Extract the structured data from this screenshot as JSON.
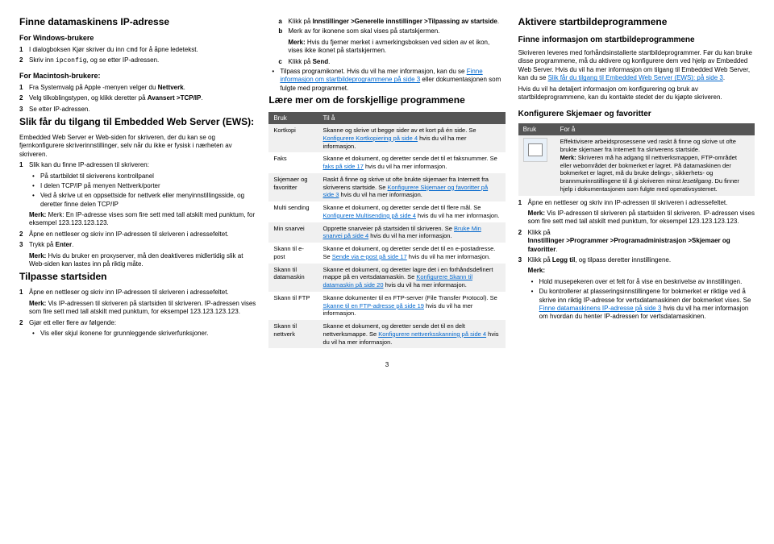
{
  "col1": {
    "h1": "Finne datamaskinens IP-adresse",
    "h2a": "For Windows-brukere",
    "s1": "I dialogboksen Kjør skriver du inn ",
    "s1_mono": "cmd",
    "s1_end": " for å åpne ledetekst.",
    "s2": "Skriv inn ",
    "s2_mono": "ipconfig",
    "s2_end": ", og se etter IP-adressen.",
    "h2b": "For Macintosh-brukere:",
    "m1": "Fra Systemvalg på Apple -menyen velger du ",
    "m1b": "Nettverk",
    "m2": "Velg tilkoblingstypen, og klikk deretter på ",
    "m2b": "Avansert >TCP/IP",
    "m3": "Se etter IP-adressen.",
    "h1b": "Slik får du tilgang til Embedded Web Server (EWS):",
    "p1": "Embedded Web Server er Web-siden for skriveren, der du kan se og fjernkonfigurere skriverinnstillinger, selv når du ikke er fysisk i nærheten av skriveren.",
    "e1": "Slik kan du finne IP-adressen til skriveren:",
    "b1": "På startbildet til skriverens kontrollpanel",
    "b2": "I delen TCP/IP på menyen Nettverk/porter",
    "b3": "Ved å skrive ut en oppsettside for nettverk eller menyinnstillingsside, og deretter finne delen TCP/IP",
    "note1": "Merk: En IP-adresse vises som fire sett med tall atskilt med punktum, for eksempel 123.123.123.123.",
    "e2": "Åpne en nettleser og skriv inn IP-adressen til skriveren i adressefeltet.",
    "e3": "Trykk på ",
    "e3b": "Enter",
    "note2a": "Merk:",
    "note2b": " Hvis du bruker en proxyserver, må den deaktiveres midlertidig slik at Web-siden kan lastes inn på riktig måte.",
    "h1c": "Tilpasse startsiden",
    "t1": "Åpne en nettleser og skriv inn IP-adressen til skriveren i adressefeltet.",
    "tnote_a": "Merk:",
    "tnote_b": " Vis IP-adressen til skriveren på startsiden til skriveren. IP-adressen vises som fire sett med tall atskilt med punktum, for eksempel 123.123.123.123.",
    "t2": "Gjør ett eller flere av følgende:",
    "tb1": "Vis eller skjul ikonene for grunnleggende skriverfunksjoner."
  },
  "col2": {
    "sa": "Klikk på ",
    "sab": "Innstillinger >Generelle innstillinger >Tilpassing av startside",
    "sb": "Merk av for ikonene som skal vises på startskjermen.",
    "merk_a": "Merk:",
    "merk_b": " Hvis du fjerner merket i avmerkingsboksen ved siden av et ikon, vises ikke ikonet på startskjermen.",
    "sc": "Klikk på ",
    "scb": "Send",
    "bul1": "Tilpass programikonet. Hvis du vil ha mer informasjon, kan du se ",
    "bul1_link": "Finne informasjon om startbildeprogrammene på side 3",
    "bul1_end": " eller dokumentasjonen som fulgte med programmet.",
    "h1": "Lære mer om de forskjellige programmene",
    "th1": "Bruk",
    "th2": "Til å",
    "r1a": "Kortkopi",
    "r1b": "Skanne og skrive ut begge sider av et kort på én side. Se ",
    "r1l": "Konfigurere Kortkopiering på side 4",
    "r1e": " hvis du vil ha mer informasjon.",
    "r2a": "Faks",
    "r2b": "Skanne et dokument, og deretter sende det til et faksnummer. Se ",
    "r2l": "faks på side 17",
    "r2e": " hvis du vil ha mer informasjon.",
    "r3a": "Skjemaer og favoritter",
    "r3b": "Raskt å finne og skrive ut ofte brukte skjemaer fra Internett fra skriverens startside. Se ",
    "r3l": "Konfigurere Skjemaer og favoritter på side 3",
    "r3e": " hvis du vil ha mer informasjon.",
    "r4a": "Multi sending",
    "r4b": "Skanne et dokument, og deretter sende det til flere mål. Se ",
    "r4l": "Konfigurere Multisending på side 4",
    "r4e": " hvis du vil ha mer informasjon.",
    "r5a": "Min snarvei",
    "r5b": "Opprette snarveier på startsiden til skriveren. Se ",
    "r5l": "Bruke Min snarvei på side 4",
    "r5e": " hvis du vil ha mer informasjon.",
    "r6a": "Skann til e-post",
    "r6b": "Skanne et dokument, og deretter sende det til en e-postadresse. Se ",
    "r6l": "Sende via e-post på side 17",
    "r6e": " hvis du vil ha mer informasjon.",
    "r7a": "Skann til datamaskin",
    "r7b": "Skanne et dokument, og deretter lagre det i en forhåndsdefinert mappe på en vertsdatamaskin. Se ",
    "r7l": "Konfigurere Skann til datamaskin på side 20",
    "r7e": " hvis du vil ha mer informasjon.",
    "r8a": "Skann til FTP",
    "r8b": "Skanne dokumenter til en FTP-server (File Transfer Protocol). Se ",
    "r8l": "Skanne til en FTP-adresse på side 19",
    "r8e": " hvis du vil ha mer informasjon.",
    "r9a": "Skann til nettverk",
    "r9b": "Skanne et dokument, og deretter sende det til en delt nettverksmappe. Se ",
    "r9l": "Konfigurere nettverksskanning på side 4",
    "r9e": " hvis du vil ha mer informasjon."
  },
  "col3": {
    "h1": "Aktivere startbildeprogrammene",
    "h2": "Finne informasjon om startbildeprogrammene",
    "p1": "Skriveren leveres med forhåndsinstallerte startbildeprogrammer. Før du kan bruke disse programmene, må du aktivere og konfigurere dem ved hjelp av Embedded Web Server. Hvis du vil ha mer informasjon om tilgang til Embedded Web Server, kan du se ",
    "p1l": "Slik får du tilgang til Embedded Web Server (EWS): på side 3",
    "p2": "Hvis du vil ha detaljert informasjon om konfigurering og bruk av startbildeprogrammene, kan du kontakte stedet der du kjøpte skriveren.",
    "h2b": "Konfigurere Skjemaer og favoritter",
    "th1": "Bruk",
    "th2": "For å",
    "fav1": "Effektivisere arbeidsprosessene ved raskt å finne og skrive ut ofte brukte skjemaer fra Internett fra skriverens startside.",
    "fav2a": "Merk:",
    "fav2b": " Skriveren må ha adgang til nettverksmappen, FTP-området eller webområdet der bokmerket er lagret. På datamaskinen der bokmerket er lagret, må du bruke delings-, sikkerhets- og brannmurinnstillingene til å gi skriveren minst ",
    "fav2i": "lesetilgang",
    "fav2c": ". Du finner hjelp i dokumentasjonen som fulgte med operativsystemet.",
    "s1": "Åpne en nettleser og skriv inn IP-adressen til skriveren i adressefeltet.",
    "note_a": "Merk:",
    "note_b": " Vis IP-adressen til skriveren på startsiden til skriveren. IP-adressen vises som fire sett med tall atskilt med punktum, for eksempel 123.123.123.123.",
    "s2a": "Klikk på",
    "s2b": "Innstillinger >Programmer >Programadministrasjon >Skjemaer og favoritter",
    "s3a": "Klikk på ",
    "s3b": "Legg til",
    "s3c": ", og tilpass deretter innstillingene.",
    "merk": "Merk:",
    "mb1": "Hold musepekeren over et felt for å vise en beskrivelse av innstillingen.",
    "mb2": "Du kontrollerer at plasseringsinnstillingene for bokmerket er riktige ved å skrive inn riktig IP-adresse for vertsdatamaskinen der bokmerket vises. Se ",
    "mb2l": "Finne datamaskinens IP-adresse på side 3",
    "mb2e": " hvis du vil ha mer informasjon om hvordan du henter IP-adressen for vertsdatamaskinen."
  },
  "page": "3"
}
